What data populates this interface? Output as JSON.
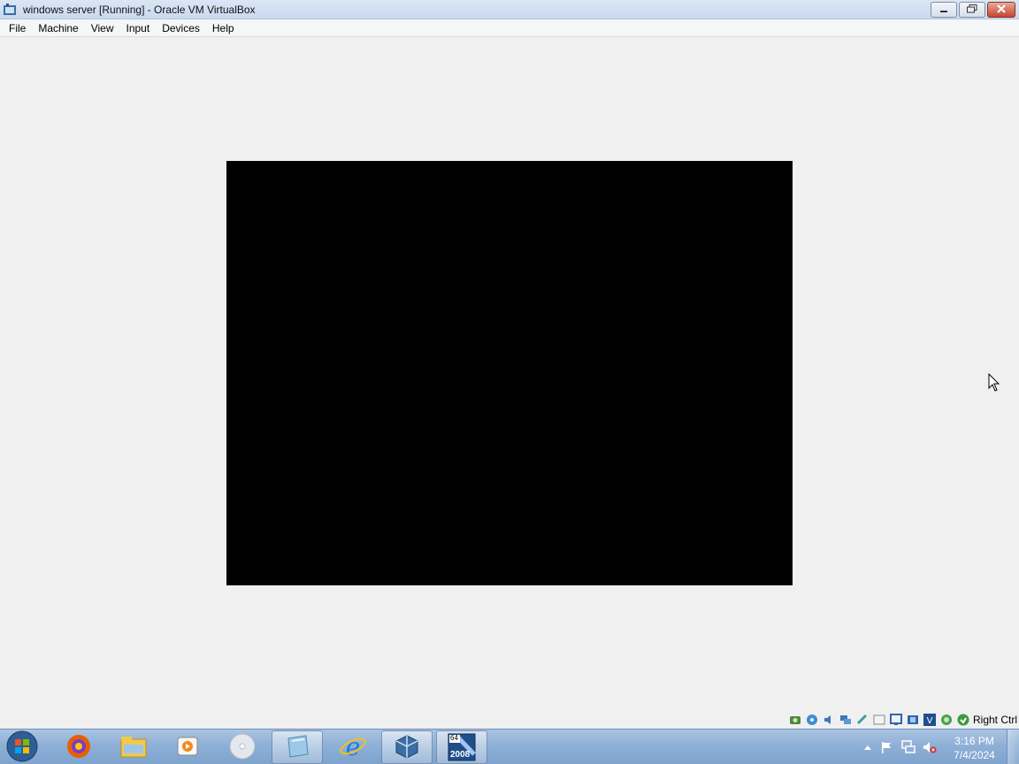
{
  "window": {
    "title": "windows server [Running] - Oracle VM VirtualBox",
    "app_icon": "virtualbox-icon",
    "controls": [
      "minimize-icon",
      "restore-icon",
      "close-icon"
    ]
  },
  "menubar": {
    "items": [
      "File",
      "Machine",
      "View",
      "Input",
      "Devices",
      "Help"
    ]
  },
  "vm_display": {
    "screen_color": "#000000"
  },
  "statusbar": {
    "icons": [
      "hard-disk-icon",
      "optical-drive-icon",
      "audio-icon",
      "network-icon",
      "usb-icon",
      "shared-folders-icon",
      "display-icon",
      "video-capture-icon",
      "virtualization-icon",
      "mouse-integration-icon",
      "keyboard-capture-icon"
    ],
    "host_key": "Right Ctrl"
  },
  "taskbar": {
    "start_icon": "windows-start-icon",
    "apps": [
      {
        "name": "firefox",
        "icon": "firefox-icon"
      },
      {
        "name": "file-explorer",
        "icon": "folder-icon"
      },
      {
        "name": "media-player",
        "icon": "media-player-icon"
      },
      {
        "name": "disc-burner",
        "icon": "disc-icon"
      },
      {
        "name": "notepad",
        "icon": "notepad-icon"
      },
      {
        "name": "internet-explorer",
        "icon": "internet-explorer-icon"
      },
      {
        "name": "virtualbox",
        "icon": "virtualbox-icon"
      },
      {
        "name": "windows-server-2008",
        "icon": "server-2008-icon",
        "badge_top": "64",
        "badge_bottom": "2008"
      }
    ],
    "tray": {
      "icons": [
        "show-hidden-icons-icon",
        "action-center-flag-icon",
        "network-tray-icon",
        "volume-muted-icon"
      ],
      "time": "3:16 PM",
      "date": "7/4/2024"
    }
  },
  "colors": {
    "taskbar": "#8fb0d6",
    "background": "#f0f0f0",
    "close_button": "#c6452c"
  }
}
